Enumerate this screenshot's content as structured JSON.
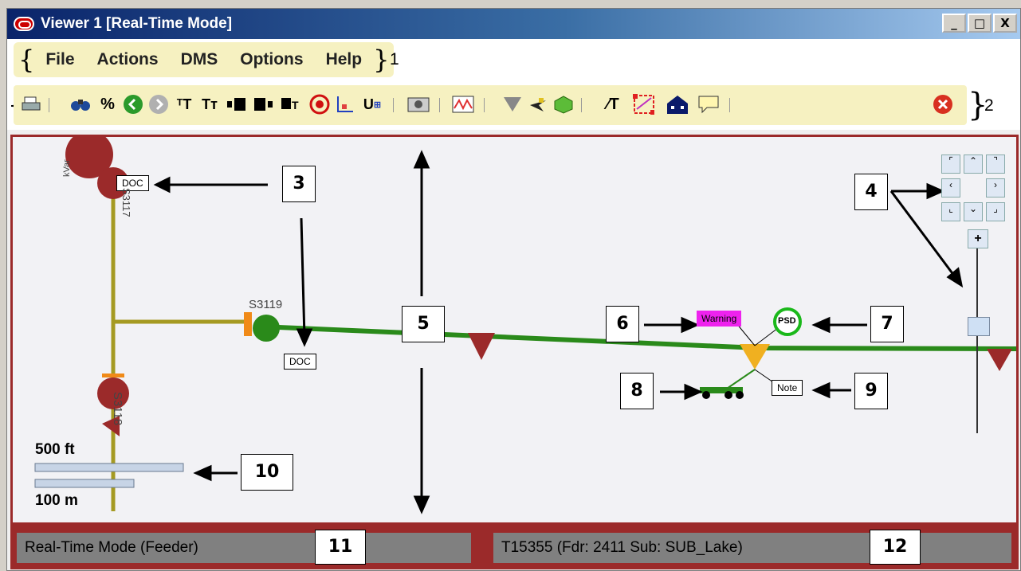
{
  "window": {
    "title": "Viewer 1 [Real-Time Mode]",
    "controls": [
      "_",
      "□",
      "X"
    ]
  },
  "menu": {
    "items": [
      "File",
      "Actions",
      "DMS",
      "Options",
      "Help"
    ],
    "callout": "1"
  },
  "toolbar": {
    "callout": "2",
    "icons": [
      "print-icon",
      "binoculars-icon",
      "percent-icon",
      "back-icon",
      "forward-icon",
      "text-larger-icon",
      "text-smaller-icon",
      "align-left-icon",
      "align-right-icon",
      "align-top-icon",
      "target-icon",
      "chart-icon",
      "u-icon",
      "camera-icon",
      "graph-icon",
      "triangle-icon",
      "plane-icon",
      "cube-icon",
      "ct-icon",
      "network-icon",
      "house-icon",
      "note-icon",
      "cancel-icon"
    ]
  },
  "map": {
    "labels": {
      "doc1": "DOC",
      "doc2": "DOC",
      "s3119": "S3119",
      "s3118": "S3118",
      "s3117": "S3117",
      "kvar": "kVar",
      "warning": "Warning",
      "psd": "PSD",
      "note": "Note"
    },
    "scale": {
      "ft": "500 ft",
      "m": "100 m"
    },
    "callouts": [
      "3",
      "4",
      "5",
      "6",
      "7",
      "8",
      "9",
      "10"
    ]
  },
  "status": {
    "left": "Real-Time Mode (Feeder)",
    "right": "T15355 (Fdr: 2411 Sub: SUB_Lake)",
    "callouts": [
      "11",
      "12"
    ]
  },
  "colors": {
    "frame": "#9b2a2a",
    "line_green": "#2a8a1a",
    "line_olive": "#a59a22",
    "device_red": "#9b2a2a"
  }
}
